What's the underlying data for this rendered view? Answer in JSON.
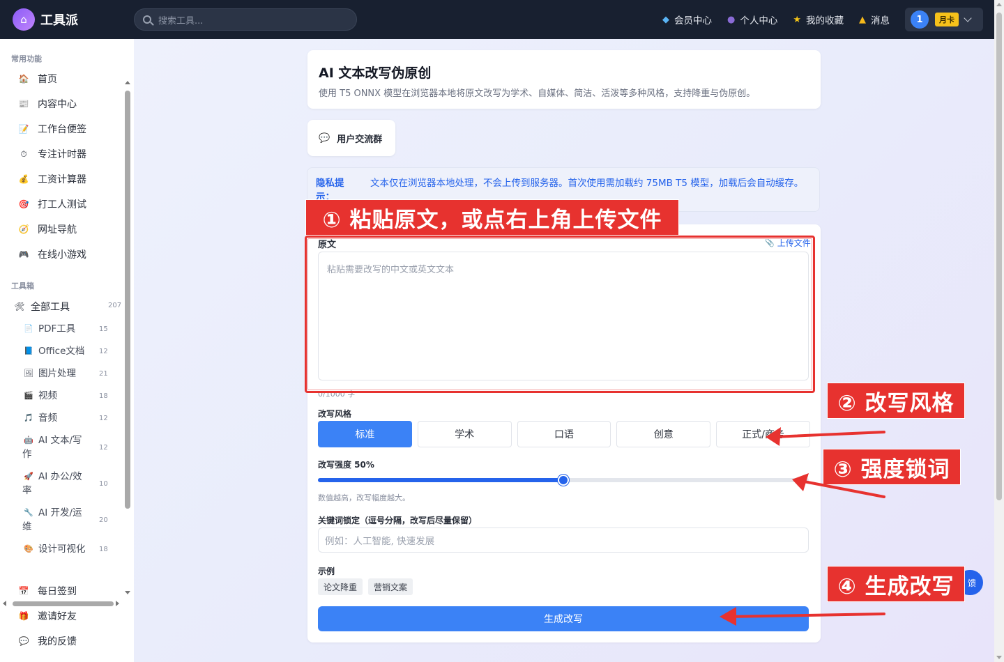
{
  "header": {
    "brand": "工具派",
    "search_placeholder": "搜索工具...",
    "nav": [
      {
        "label": "会员中心",
        "icon": "diamond-icon"
      },
      {
        "label": "个人中心",
        "icon": "user-icon"
      },
      {
        "label": "我的收藏",
        "icon": "star-icon"
      },
      {
        "label": "消息",
        "icon": "bell-icon"
      }
    ],
    "user_badge": "1",
    "vip_label": "月卡"
  },
  "sidebar": {
    "common_title": "常用功能",
    "common": [
      {
        "label": "首页",
        "icon": "home-icon"
      },
      {
        "label": "内容中心",
        "icon": "news-icon"
      },
      {
        "label": "工作台便签",
        "icon": "memo-icon"
      },
      {
        "label": "专注计时器",
        "icon": "stopwatch-icon"
      },
      {
        "label": "工资计算器",
        "icon": "money-bag-icon"
      },
      {
        "label": "打工人测试",
        "icon": "target-icon"
      },
      {
        "label": "网址导航",
        "icon": "compass-icon"
      },
      {
        "label": "在线小游戏",
        "icon": "gamepad-icon"
      }
    ],
    "toolbox_title": "工具箱",
    "all_tools": {
      "label": "全部工具",
      "count": "207"
    },
    "categories": [
      {
        "label": "PDF工具",
        "count": "15",
        "icon": "pdf-icon"
      },
      {
        "label": "Office文档",
        "count": "12",
        "icon": "book-icon"
      },
      {
        "label": "图片处理",
        "count": "21",
        "icon": "image-icon"
      },
      {
        "label": "视频",
        "count": "18",
        "icon": "video-icon"
      },
      {
        "label": "音频",
        "count": "12",
        "icon": "music-icon"
      },
      {
        "label_1": "AI 文本/写",
        "label_2": "作",
        "count": "12",
        "icon": "robot-icon"
      },
      {
        "label_1": "AI 办公/效",
        "label_2": "率",
        "count": "10",
        "icon": "rocket-icon"
      },
      {
        "label_1": "AI 开发/运",
        "label_2": "维",
        "count": "20",
        "icon": "wrench-icon"
      },
      {
        "label": "设计可视化",
        "count": "18",
        "icon": "palette-icon"
      }
    ],
    "bottom": [
      {
        "label": "每日签到",
        "icon": "calendar-icon"
      },
      {
        "label": "邀请好友",
        "icon": "gift-icon"
      },
      {
        "label": "我的反馈",
        "icon": "speech-bubble-icon"
      }
    ]
  },
  "page": {
    "title": "AI 文本改写伪原创",
    "description": "使用 T5 ONNX 模型在浏览器本地将原文改写为学术、自媒体、简洁、活泼等多种风格，支持降重与伪原创。",
    "group_label": "用户交流群",
    "privacy_label": "隐私提示：",
    "privacy_text": "文本仅在浏览器本地处理，不会上传到服务器。首次使用需加载约 75MB T5 模型，加载后会自动缓存。",
    "source_label": "原文",
    "upload_label": "上传文件",
    "source_placeholder": "粘贴需要改写的中文或英文文本",
    "char_count": "0/1000 字",
    "style_label": "改写风格",
    "styles": [
      "标准",
      "学术",
      "口语",
      "创意",
      "正式/商务"
    ],
    "active_style": 0,
    "strength_label": "改写强度 50%",
    "strength_value": 50,
    "strength_hint": "数值越高，改写幅度越大。",
    "keyword_label": "关键词锁定（逗号分隔，改写后尽量保留）",
    "keyword_placeholder": "例如：人工智能, 快速发展",
    "examples_label": "示例",
    "examples": [
      "论文降重",
      "营销文案"
    ],
    "generate_label": "生成改写",
    "feedback_fab": "馈"
  },
  "annotations": {
    "step1": "① 粘贴原文，或点右上角上传文件",
    "step2": "② 改写风格",
    "step3": "③ 强度锁词",
    "step4": "④ 生成改写",
    "color": "#e7322f"
  }
}
